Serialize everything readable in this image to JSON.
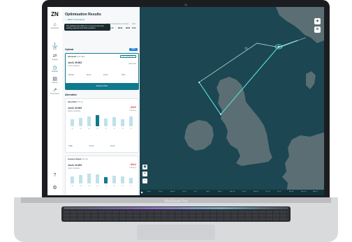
{
  "device": {
    "brand_label": "MacBook Pro"
  },
  "nav": {
    "logo": "ZN",
    "items": [
      {
        "label": "Dashboard",
        "icon": "home-icon",
        "active": false
      },
      {
        "label": "Fleet",
        "icon": "ship-icon",
        "active": false
      },
      {
        "label": "Voyages",
        "icon": "route-icon",
        "active": false
      },
      {
        "label": "Optimise",
        "icon": "optimise-icon",
        "active": true
      },
      {
        "label": "Reports",
        "icon": "report-icon",
        "active": false
      },
      {
        "label": "Performance",
        "icon": "chart-icon",
        "active": false
      }
    ],
    "help_icon": "help-icon",
    "settings_icon": "gear-icon"
  },
  "panel": {
    "title": "Optimisation Results",
    "back_link": "← Back to Scenarios",
    "tooltip": "The optimal route will E.T.A. in terms of your fuel setting, exposure and CO2 emissions",
    "charter_headers": [
      "Arrival Window",
      "Charter Rate",
      "CII",
      "EEXI"
    ],
    "charter_values": [
      "Jun 8",
      "$24k",
      "2023",
      "2/14"
    ],
    "optimal": {
      "section_label": "Optimal",
      "new_label": "NEW",
      "card": {
        "name": "Zerotech",
        "sub": "AIS-NEX",
        "badge": "RECOMMENDED",
        "route": "Jun 8, 09:50Z",
        "route_sub": "Good conditions",
        "status": "Selected",
        "metrics": [
          "18.2 kn",
          "42 mt",
          "13 nm",
          "CII A"
        ],
        "review_button": "Review Plan"
      }
    },
    "alternative": {
      "section_label": "Alternative",
      "cards": [
        {
          "name": "ZeroTech",
          "sub": "CIT kn",
          "route": "Jun 8, 04:00Z",
          "route_sub": "Mostly conditions",
          "cost": "- $320",
          "cost_sub": "ETA delay",
          "bars": [
            12,
            15,
            18,
            20,
            14,
            16,
            13,
            17
          ],
          "bar_dark_index": 3,
          "bar_labels": [
            "00",
            "03",
            "06",
            "09",
            "12",
            "15",
            "18",
            "21"
          ],
          "metrics": [
            "3.2kn",
            "41 mt",
            "10 nm"
          ]
        },
        {
          "name": "Custom Route",
          "sub": "SCI kn",
          "route": "Jun 8, 04:30Z",
          "route_sub": "Good conditions",
          "cost": "- $624",
          "cost_sub": "ETA delay",
          "bars": [
            13,
            15,
            18,
            16,
            11,
            14,
            12,
            10
          ],
          "bar_dark_index": 4,
          "bar_labels": [
            "00",
            "03",
            "06",
            "09",
            "12",
            "15",
            "18",
            "21"
          ],
          "metrics": []
        }
      ]
    }
  },
  "map": {
    "layers_icon": "layers-icon",
    "settings_icon": "settings-icon",
    "locate_icon": "locate-icon",
    "zoom_in_label": "+",
    "zoom_out_label": "−",
    "timeline": {
      "play_icon": "play-icon",
      "days": [
        "Today",
        "Tue 4",
        "Wed 5",
        "Thu 6",
        "Fri 7",
        "Sat 8",
        "Sun 9",
        "Mon 10",
        "Tue 11",
        "Wed 12",
        "Thu 13",
        "Fri 14",
        "Sat 15",
        "Sun 16",
        "Mon 17"
      ],
      "active_index": 0
    }
  },
  "colors": {
    "accent": "#0f7a8c",
    "route_primary": "#55d6c9",
    "route_alt": "#a7ded6",
    "land": "#5a6e74",
    "sea": "#1b4652",
    "cost_negative": "#e0443b"
  }
}
